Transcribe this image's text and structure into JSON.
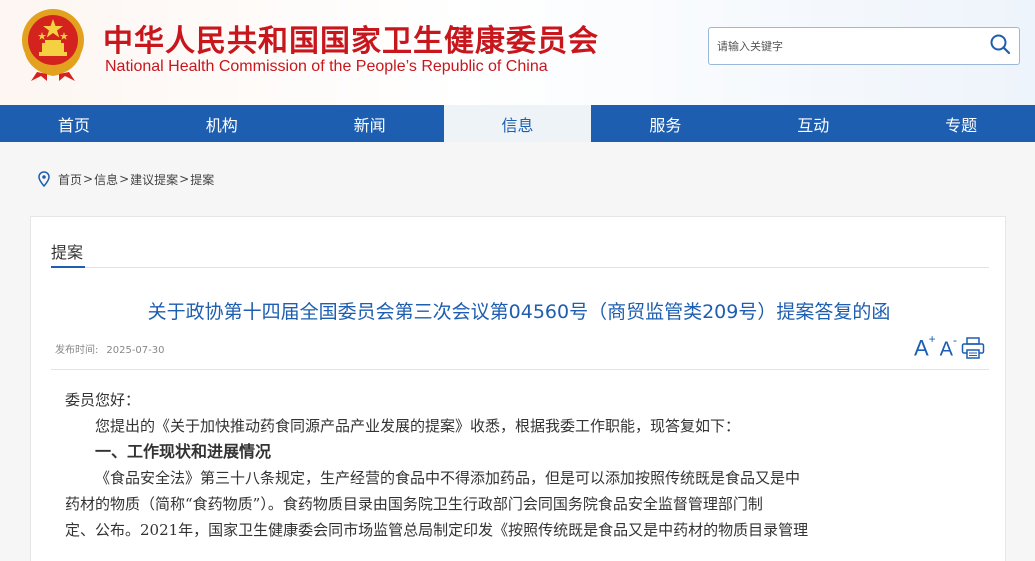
{
  "header": {
    "title_cn": "中华人民共和国国家卫生健康委员会",
    "title_en": "National Health Commission of the People’s Republic of China",
    "emblem_icon": "national-emblem-icon",
    "accent_color": "#c8161d"
  },
  "search": {
    "placeholder": "请输入关键字",
    "icon": "search-icon"
  },
  "nav": {
    "color": "#1d5eb0",
    "items": [
      {
        "label": "首页"
      },
      {
        "label": "机构"
      },
      {
        "label": "新闻"
      },
      {
        "label": "信息",
        "active": true
      },
      {
        "label": "服务"
      },
      {
        "label": "互动"
      },
      {
        "label": "专题"
      }
    ]
  },
  "breadcrumb": {
    "icon": "location-pin-icon",
    "items": [
      "首页",
      "信息",
      "建议提案",
      "提案"
    ],
    "separator": ">"
  },
  "section": {
    "tab_label": "提案"
  },
  "article": {
    "title": "关于政协第十四届全国委员会第三次会议第04560号（商贸监管类209号）提案答复的函",
    "date_label": "发布时间:",
    "date_value": "2025-07-30",
    "tools": {
      "font_larger": "A",
      "font_smaller": "A",
      "print_icon": "print-icon"
    },
    "greeting": "委员您好：",
    "intro": "您提出的《关于加快推动药食同源产品产业发展的提案》收悉，根据我委工作职能，现答复如下：",
    "heading1": "一、工作现状和进展情况",
    "para1_line1": "《食品安全法》第三十八条规定，生产经营的食品中不得添加药品，但是可以添加按照传统既是食品又是中",
    "para1_line2": "药材的物质（简称“食药物质”）。食药物质目录由国务院卫生行政部门会同国务院食品安全监督管理部门制",
    "para1_line3": "定、公布。2021年，国家卫生健康委会同市场监管总局制定印发《按照传统既是食品又是中药材的物质目录管理"
  }
}
